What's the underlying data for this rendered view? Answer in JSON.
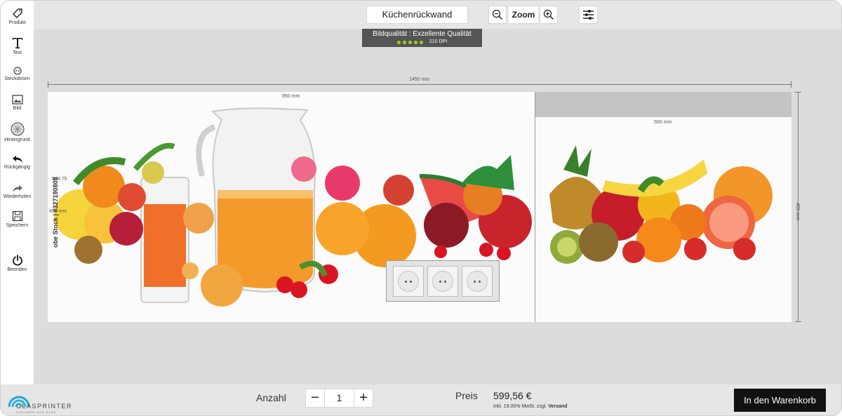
{
  "sidebar": {
    "items": [
      {
        "label": "Produkt",
        "icon": "tag-icon"
      },
      {
        "label": "Text",
        "icon": "text-icon"
      },
      {
        "label": "Steckdosen",
        "icon": "socket-icon"
      },
      {
        "label": "Bild",
        "icon": "image-icon"
      },
      {
        "label": "Hintergrund",
        "icon": "background-icon"
      },
      {
        "label": "Rückgängig",
        "icon": "undo-icon"
      },
      {
        "label": "Wiederholen",
        "icon": "redo-icon"
      },
      {
        "label": "Speichern",
        "icon": "save-icon"
      },
      {
        "label": "Beenden",
        "icon": "power-icon"
      }
    ]
  },
  "header": {
    "title": "Küchenrückwand",
    "zoom_label": "Zoom"
  },
  "quality": {
    "text": "Bildqualität : Exzellente Qualität",
    "stars": 5,
    "dpi": "210 DPI",
    "color": "#9bd11a"
  },
  "canvas": {
    "total_width": "1450 mm",
    "left_width": "950 mm",
    "right_width": "500 mm",
    "height": "450 mm",
    "left_height_label": "548.75",
    "left_height_label2": "450 mm",
    "watermark": "obe Stock | #327190809",
    "socket_count": 3
  },
  "footer": {
    "brand": "GLASPRINTER",
    "tagline": "VISIONEN AUS GLAS",
    "quantity_label": "Anzahl",
    "quantity": "1",
    "minus": "−",
    "plus": "+",
    "price_label": "Preis",
    "price": "599,56 €",
    "price_note": "Inkl. 19.00% MwSt. zzgl.",
    "price_note_strong": "Versand",
    "cart_label": "In den Warenkorb"
  }
}
